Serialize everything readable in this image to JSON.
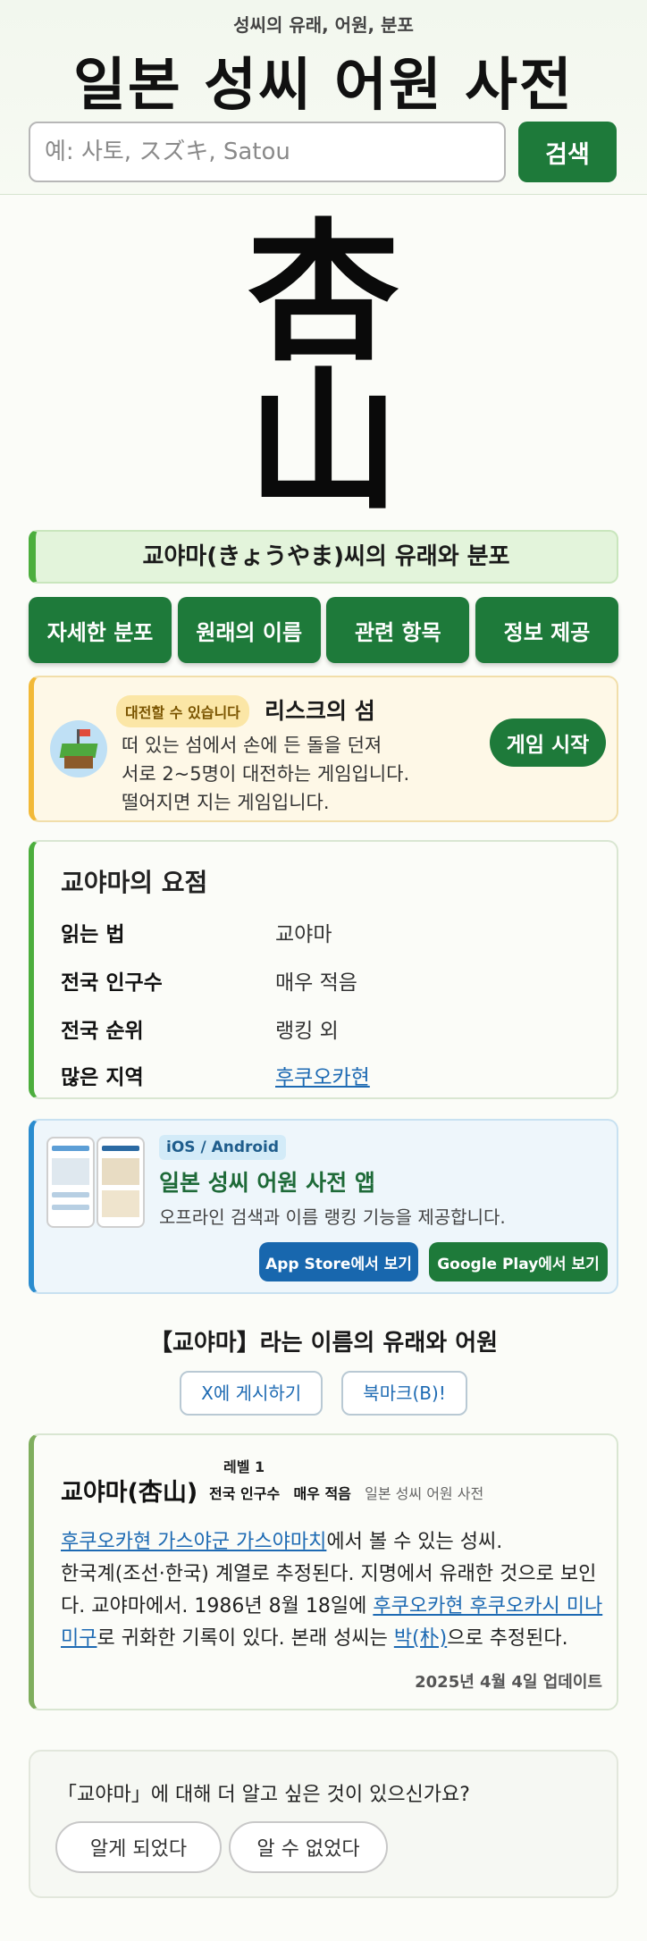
{
  "header": {
    "subtitle": "성씨의 유래, 어원, 분포",
    "title": "일본 성씨 어원 사전",
    "search_placeholder": "예: 사토, スズキ, Satou",
    "search_button": "검색"
  },
  "surname": {
    "kanji_top": "杏",
    "kanji_bottom": "山",
    "section_title": "교야마(きょうやま)씨의 유래와 분포"
  },
  "nav": [
    "자세한 분포",
    "원래의 이름",
    "관련 항목",
    "정보 제공"
  ],
  "game": {
    "badge": "대전할 수 있습니다",
    "title": "리스크의 섬",
    "desc_line1": "떠 있는 섬에서 손에 든 돌을 던져",
    "desc_line2": "서로 2~5명이 대전하는 게임입니다.",
    "desc_line3": "떨어지면 지는 게임입니다.",
    "button": "게임 시작"
  },
  "summary": {
    "title": "교야마의 요점",
    "rows": [
      {
        "label": "읽는 법",
        "value": "교야마"
      },
      {
        "label": "전국 인구수",
        "value": "매우 적음"
      },
      {
        "label": "전국 순위",
        "value": "랭킹 외"
      },
      {
        "label": "많은 지역",
        "value": "후쿠오카현"
      }
    ]
  },
  "app": {
    "badge": "iOS / Android",
    "title": "일본 성씨 어원 사전 앱",
    "desc": "오프라인 검색과 이름 랭킹 기능을 제공합니다.",
    "ios_button": "App Store에서 보기",
    "android_button": "Google Play에서 보기"
  },
  "origin": {
    "heading": "【교야마】라는 이름의 유래와 어원",
    "share_x": "X에 게시하기",
    "bookmark": "북마크(B)!"
  },
  "detail": {
    "name": "교야마(杏山)",
    "level": "레벨 1",
    "pop_label": "전국 인구수",
    "pop_value": "매우 적음",
    "source": "일본 성씨 어원 사전",
    "link1": "후쿠오카현 가스야군 가스야마치",
    "text1": "에서 볼 수 있는 성씨.",
    "text2": "한국계(조선·한국) 계열로 추정된다. 지명에서 유래한 것으로 보인다. 교야마에서. 1986년 8월 18일에 ",
    "link2": "후쿠오카현 후쿠오카시 미나미구",
    "text3": "로 귀화한 기록이 있다. 본래 성씨는 ",
    "link3": "박(朴)",
    "text4": "으로 추정된다.",
    "updated": "2025년 4월 4일 업데이트"
  },
  "feedback": {
    "question": "「교야마」에 대해 더 알고 싶은 것이 있으신가요?",
    "yes": "알게 되었다",
    "no": "알 수 없었다"
  }
}
